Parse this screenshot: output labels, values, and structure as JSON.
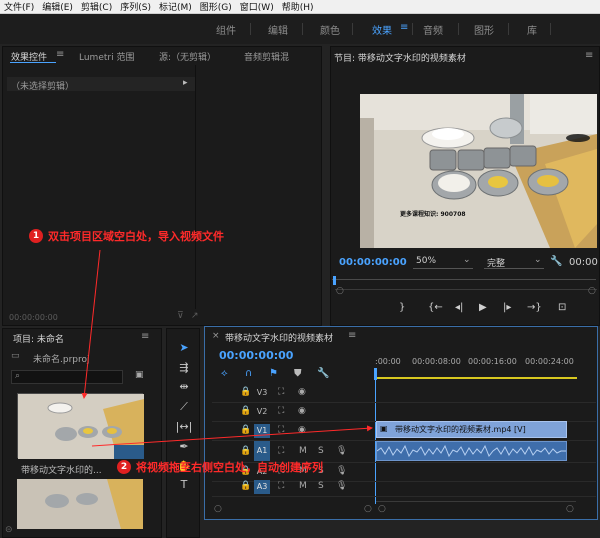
{
  "menu": [
    "文件(F)",
    "编辑(E)",
    "剪辑(C)",
    "序列(S)",
    "标记(M)",
    "图形(G)",
    "窗口(W)",
    "帮助(H)"
  ],
  "workspaces": [
    "组件",
    "编辑",
    "颜色",
    "效果",
    "音频",
    "图形",
    "库"
  ],
  "effect_panel": {
    "tabs": [
      "效果控件",
      "Lumetri 范围",
      "源:（无剪辑）",
      "音频剪辑混"
    ],
    "no_clip": "（未选择剪辑）",
    "timecode": "00:00:00:00"
  },
  "program": {
    "title": "节目: 带移动文字水印的视频素材",
    "timecode": "00:00:00:00",
    "zoom": "50%",
    "quality": "完整",
    "duration": "00:00",
    "watermark": "更多课程知识:    900708"
  },
  "project": {
    "title": "项目: 未命名",
    "file": "未命名.prproj",
    "clip_name": "带移动文字水印的..."
  },
  "timeline": {
    "title": "带移动文字水印的视频素材",
    "timecode": "00:00:00:00",
    "ruler": [
      ":00:00",
      "00:00:08:00",
      "00:00:16:00",
      "00:00:24:00"
    ],
    "tracks": [
      "V3",
      "V2",
      "V1",
      "A1",
      "A2",
      "A3"
    ],
    "clip_label": "带移动文字水印的视频素材.mp4 [V]",
    "mute": "M",
    "solo": "S"
  },
  "annotations": {
    "step1_num": "1",
    "step1": "双击项目区域空白处，导入视频文件",
    "step2_num": "2",
    "step2": "将视频拖至右侧空白处，自动创建序列"
  },
  "colors": {
    "accent": "#4aa3ff",
    "annotation": "#ff2a2a",
    "clip_video": "#7fa3d9",
    "clip_audio": "#3f6eab"
  }
}
